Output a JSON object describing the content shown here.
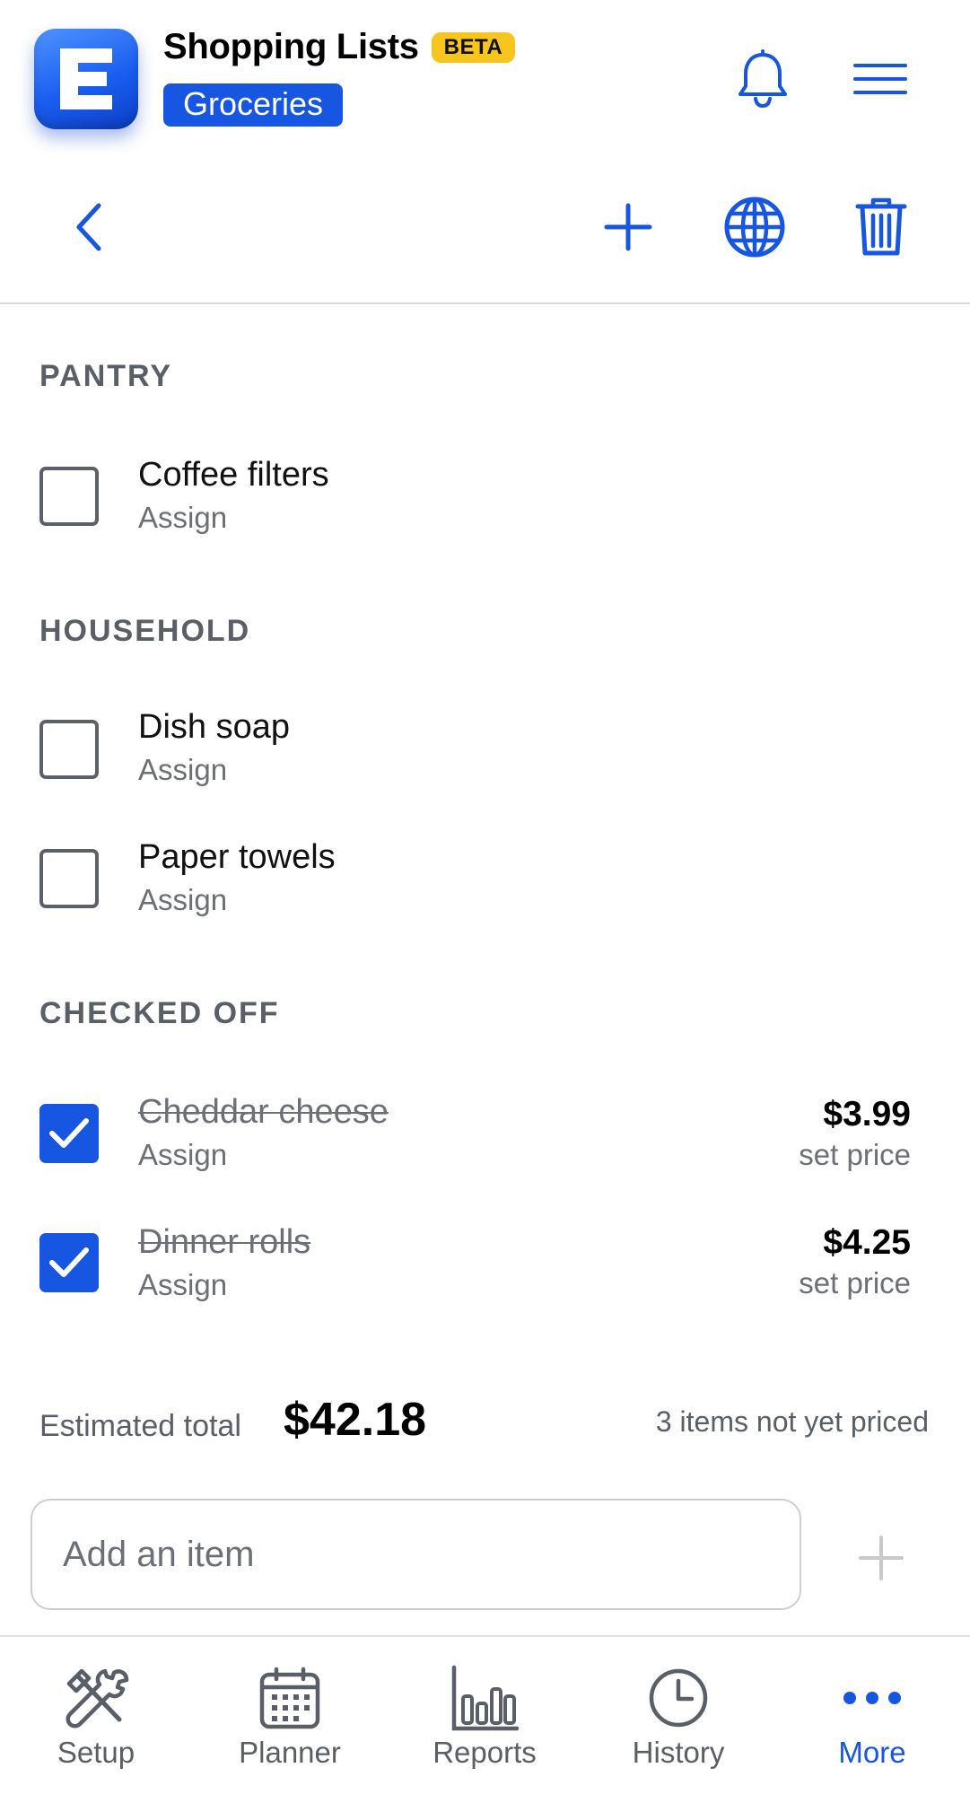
{
  "header": {
    "app_title": "Shopping Lists",
    "badge": "BETA",
    "list_name": "Groceries",
    "logo_letter": "E"
  },
  "icons": {
    "bell": "bell-icon",
    "menu": "hamburger-menu-icon",
    "back": "chevron-left-icon",
    "add": "plus-icon",
    "globe": "globe-icon",
    "trash": "trash-icon"
  },
  "colors": {
    "accent": "#1656e0",
    "badge": "#f7c51e",
    "muted": "#6c6f76",
    "section": "#5a5e66"
  },
  "sections": [
    {
      "title": "PANTRY",
      "items": [
        {
          "name": "Coffee filters",
          "assign": "Assign",
          "checked": false
        }
      ]
    },
    {
      "title": "HOUSEHOLD",
      "items": [
        {
          "name": "Dish soap",
          "assign": "Assign",
          "checked": false
        },
        {
          "name": "Paper towels",
          "assign": "Assign",
          "checked": false
        }
      ]
    },
    {
      "title": "CHECKED OFF",
      "items": [
        {
          "name": "Cheddar cheese",
          "assign": "Assign",
          "checked": true,
          "price": "$3.99",
          "price_action": "set price"
        },
        {
          "name": "Dinner rolls",
          "assign": "Assign",
          "checked": true,
          "price": "$4.25",
          "price_action": "set price"
        }
      ]
    }
  ],
  "totals": {
    "label": "Estimated total",
    "value": "$42.18",
    "unpriced_note": "3 items not yet priced"
  },
  "add_item": {
    "placeholder": "Add an item",
    "value": ""
  },
  "bottom_nav": [
    {
      "label": "Setup",
      "icon": "tools-icon",
      "active": false
    },
    {
      "label": "Planner",
      "icon": "calendar-icon",
      "active": false
    },
    {
      "label": "Reports",
      "icon": "bar-chart-icon",
      "active": false
    },
    {
      "label": "History",
      "icon": "clock-icon",
      "active": false
    },
    {
      "label": "More",
      "icon": "more-dots-icon",
      "active": true
    }
  ]
}
